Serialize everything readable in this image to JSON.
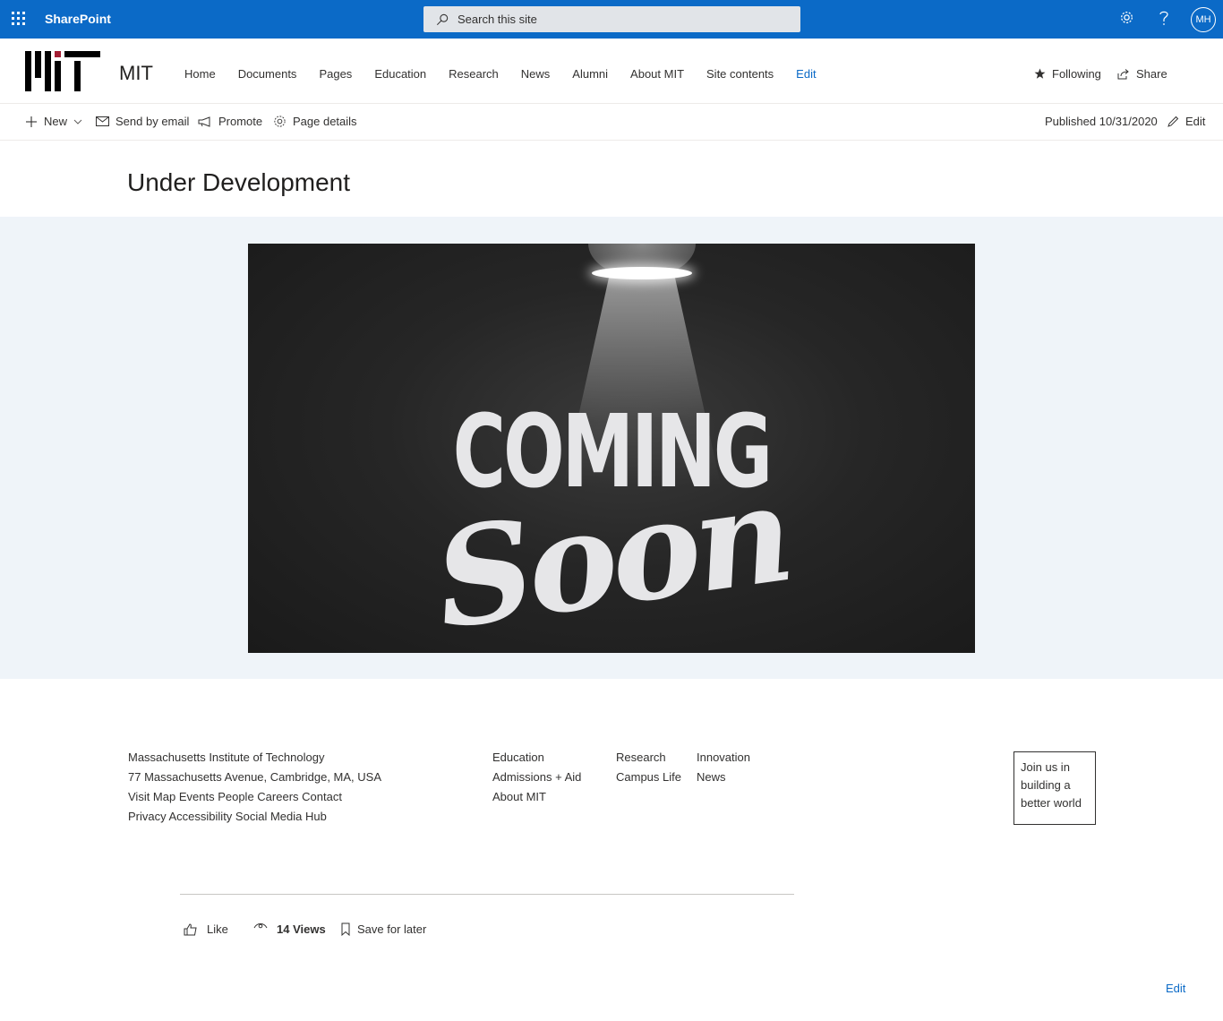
{
  "suite": {
    "app_name": "SharePoint",
    "search_placeholder": "Search this site",
    "avatar_initials": "MH"
  },
  "site": {
    "title": "MIT",
    "nav": [
      "Home",
      "Documents",
      "Pages",
      "Education",
      "Research",
      "News",
      "Alumni",
      "About MIT",
      "Site contents",
      "Edit"
    ],
    "following_label": "Following",
    "share_label": "Share"
  },
  "commandbar": {
    "new_label": "New",
    "send_label": "Send by email",
    "promote_label": "Promote",
    "details_label": "Page details",
    "published_label": "Published 10/31/2020",
    "edit_label": "Edit"
  },
  "page": {
    "title": "Under Development",
    "hero_line1": "COMING",
    "hero_line2": "Soon"
  },
  "footer": {
    "address": [
      "Massachusetts Institute of Technology",
      "77 Massachusetts Avenue, Cambridge, MA, USA",
      "Visit Map Events People Careers Contact",
      "Privacy Accessibility Social Media Hub"
    ],
    "col1": [
      "Education",
      "Admissions + Aid",
      "About MIT"
    ],
    "col2": [
      "Research",
      "Campus Life"
    ],
    "col3": [
      "Innovation",
      "News"
    ],
    "join": [
      "Join us in",
      "building a",
      "better world"
    ]
  },
  "social": {
    "like_label": "Like",
    "views_label": "14 Views",
    "save_label": "Save for later"
  },
  "bottom_edit": "Edit",
  "colors": {
    "suitebar": "#0b6ac7",
    "hero_bg": "#eff4f9",
    "accent": "#0b6ac7"
  }
}
